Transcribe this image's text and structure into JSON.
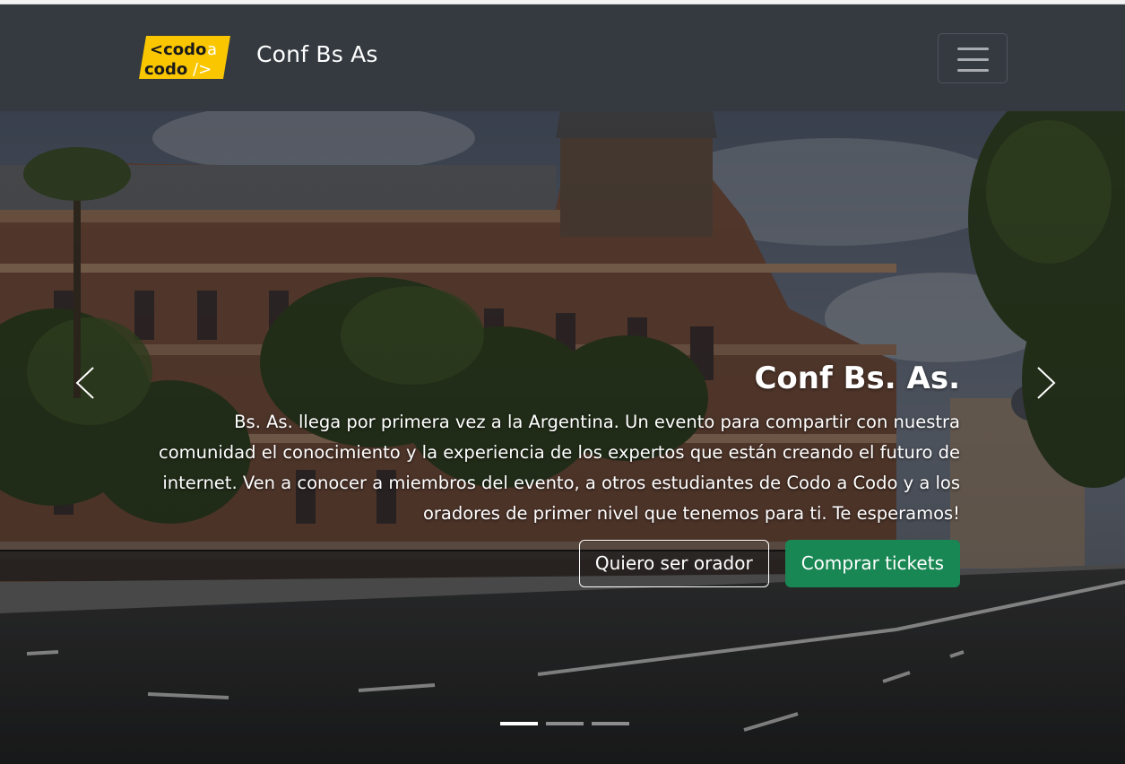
{
  "navbar": {
    "logo_text": [
      "<codo a",
      "codo />"
    ],
    "brand_name": "Conf Bs As",
    "toggler_icon": "hamburger-menu-icon"
  },
  "carousel": {
    "prev_icon": "chevron-left-icon",
    "next_icon": "chevron-right-icon",
    "caption": {
      "title": "Conf Bs. As.",
      "text": "Bs. As. llega por primera vez a la Argentina. Un evento para compartir con nuestra comunidad el conocimiento y la experiencia de los expertos que están creando el futuro de internet. Ven a conocer a miembros del evento, a otros estudiantes de Codo a Codo y a los oradores de primer nivel que tenemos para ti. Te esperamos!",
      "btn_speaker": "Quiero ser orador",
      "btn_tickets": "Comprar tickets"
    },
    "indicators": 3,
    "active_slide": 1
  },
  "colors": {
    "navbar_bg": "#343a40",
    "logo_yellow": "#f9c600",
    "success": "#198754"
  }
}
